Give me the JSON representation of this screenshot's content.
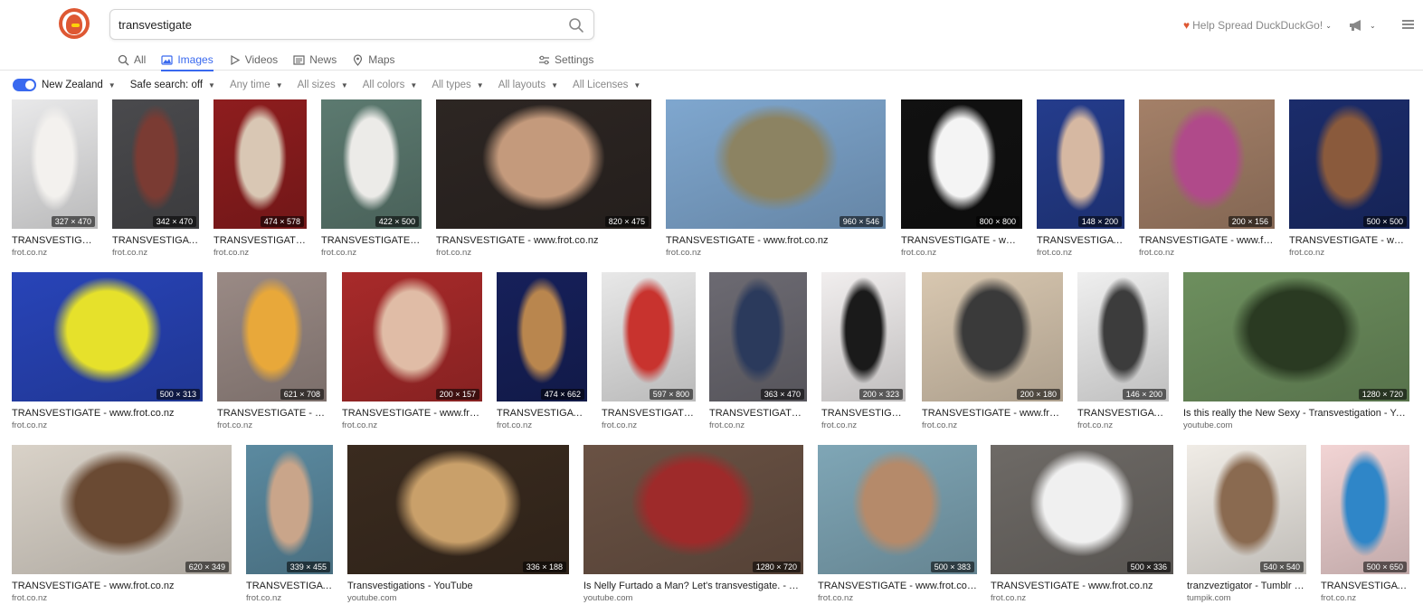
{
  "search": {
    "query": "transvestigate"
  },
  "header": {
    "help_spread": "Help Spread DuckDuckGo!"
  },
  "tabs": [
    {
      "label": "All",
      "icon": "search-icon"
    },
    {
      "label": "Images",
      "icon": "image-icon",
      "active": true
    },
    {
      "label": "Videos",
      "icon": "play-icon"
    },
    {
      "label": "News",
      "icon": "newspaper-icon"
    },
    {
      "label": "Maps",
      "icon": "map-pin-icon"
    }
  ],
  "settings_label": "Settings",
  "filters": {
    "region": "New Zealand",
    "safe_search": "Safe search: off",
    "time": "Any time",
    "sizes": "All sizes",
    "colors": "All colors",
    "types": "All types",
    "layouts": "All layouts",
    "licenses": "All Licenses"
  },
  "colors": {
    "accent": "#3969ef",
    "brand": "#de5833"
  },
  "rows": [
    [
      {
        "title": "TRANSVESTIGATE - www.frot.co.nz",
        "domain": "frot.co.nz",
        "dims": "327 × 470",
        "bg": "#e9e9ea",
        "fg": "#f3f1ee"
      },
      {
        "title": "TRANSVESTIGATE - www.frot.co.nz",
        "domain": "frot.co.nz",
        "dims": "342 × 470",
        "bg": "#4a4a4d",
        "fg": "#7a3b33"
      },
      {
        "title": "TRANSVESTIGATE - www.frot.co.nz",
        "domain": "frot.co.nz",
        "dims": "474 × 578",
        "bg": "#8e1d1e",
        "fg": "#d9c7b4"
      },
      {
        "title": "TRANSVESTIGATE - www.frot.co.nz",
        "domain": "frot.co.nz",
        "dims": "422 × 500",
        "bg": "#5c7a70",
        "fg": "#ecebe8"
      },
      {
        "title": "TRANSVESTIGATE - www.frot.co.nz",
        "domain": "frot.co.nz",
        "dims": "820 × 475",
        "bg": "#2d2623",
        "fg": "#c49a7c"
      },
      {
        "title": "TRANSVESTIGATE - www.frot.co.nz",
        "domain": "frot.co.nz",
        "dims": "960 × 546",
        "bg": "#7fa7cf",
        "fg": "#8c8362"
      },
      {
        "title": "TRANSVESTIGATE - www.frot.co.nz",
        "domain": "frot.co.nz",
        "dims": "800 × 800",
        "bg": "#111111",
        "fg": "#f4f4f4"
      },
      {
        "title": "TRANSVESTIGATE - www.frot.co.nz",
        "domain": "frot.co.nz",
        "dims": "148 × 200",
        "bg": "#243c8c",
        "fg": "#d6b8a2"
      },
      {
        "title": "TRANSVESTIGATE - www.frot.co.nz",
        "domain": "frot.co.nz",
        "dims": "200 × 156",
        "bg": "#a48068",
        "fg": "#b04a8a"
      },
      {
        "title": "TRANSVESTIGATE - www.frot.co.nz",
        "domain": "frot.co.nz",
        "dims": "500 × 500",
        "bg": "#1b2c6b",
        "fg": "#8a5a3c"
      }
    ],
    [
      {
        "title": "TRANSVESTIGATE - www.frot.co.nz",
        "domain": "frot.co.nz",
        "dims": "500 × 313",
        "bg": "#2844b8",
        "fg": "#e6e12b"
      },
      {
        "title": "TRANSVESTIGATE - www.frot.co.nz",
        "domain": "frot.co.nz",
        "dims": "621 × 708",
        "bg": "#9a8a85",
        "fg": "#e8a83a"
      },
      {
        "title": "TRANSVESTIGATE - www.frot.co.nz",
        "domain": "frot.co.nz",
        "dims": "200 × 157",
        "bg": "#a82a2a",
        "fg": "#e0bca6"
      },
      {
        "title": "TRANSVESTIGATE - www.frot.co.nz",
        "domain": "frot.co.nz",
        "dims": "474 × 662",
        "bg": "#16205a",
        "fg": "#b9864e"
      },
      {
        "title": "TRANSVESTIGATE - www.frot.co.nz",
        "domain": "frot.co.nz",
        "dims": "597 × 800",
        "bg": "#e8e8e8",
        "fg": "#c8332e"
      },
      {
        "title": "TRANSVESTIGATE - www.frot.co.nz",
        "domain": "frot.co.nz",
        "dims": "363 × 470",
        "bg": "#6c6a72",
        "fg": "#2b3a5c"
      },
      {
        "title": "TRANSVESTIGATE - www.frot.co.nz",
        "domain": "frot.co.nz",
        "dims": "200 × 323",
        "bg": "#f1eeee",
        "fg": "#1a1a1a"
      },
      {
        "title": "TRANSVESTIGATE - www.frot.co.nz",
        "domain": "frot.co.nz",
        "dims": "200 × 180",
        "bg": "#d8c7b0",
        "fg": "#3a3a3a"
      },
      {
        "title": "TRANSVESTIGATE - www.frot.co.nz",
        "domain": "frot.co.nz",
        "dims": "146 × 200",
        "bg": "#efefef",
        "fg": "#3c3c3c"
      },
      {
        "title": "Is this really the New Sexy - Transvestigation - YouTube",
        "domain": "youtube.com",
        "dims": "1280 × 720",
        "bg": "#6d8f5e",
        "fg": "#2a3a22"
      }
    ],
    [
      {
        "title": "TRANSVESTIGATE - www.frot.co.nz",
        "domain": "frot.co.nz",
        "dims": "620 × 349",
        "bg": "#d9d2c8",
        "fg": "#6a4a33"
      },
      {
        "title": "TRANSVESTIGATE - www.frot.co.nz",
        "domain": "frot.co.nz",
        "dims": "339 × 455",
        "bg": "#5b8aa0",
        "fg": "#c9a58a"
      },
      {
        "title": "Transvestigations - YouTube",
        "domain": "youtube.com",
        "dims": "336 × 188",
        "bg": "#3a2b1f",
        "fg": "#c9a06a"
      },
      {
        "title": "Is Nelly Furtado a Man? Let's transvestigate. - YouTube",
        "domain": "youtube.com",
        "dims": "1280 × 720",
        "bg": "#6a5244",
        "fg": "#9e2a2a"
      },
      {
        "title": "TRANSVESTIGATE - www.frot.co.nz",
        "domain": "frot.co.nz",
        "dims": "500 × 383",
        "bg": "#7fa6b6",
        "fg": "#b58a6a"
      },
      {
        "title": "TRANSVESTIGATE - www.frot.co.nz",
        "domain": "frot.co.nz",
        "dims": "500 × 336",
        "bg": "#6e6a66",
        "fg": "#f0f0f0"
      },
      {
        "title": "tranzveztigator - Tumblr blog",
        "domain": "tumpik.com",
        "dims": "540 × 540",
        "bg": "#f0ece6",
        "fg": "#8a6a50"
      },
      {
        "title": "TRANSVESTIGATE - www.frot.co.nz",
        "domain": "frot.co.nz",
        "dims": "500 × 650",
        "bg": "#f2d4d4",
        "fg": "#2f86c8"
      }
    ]
  ]
}
